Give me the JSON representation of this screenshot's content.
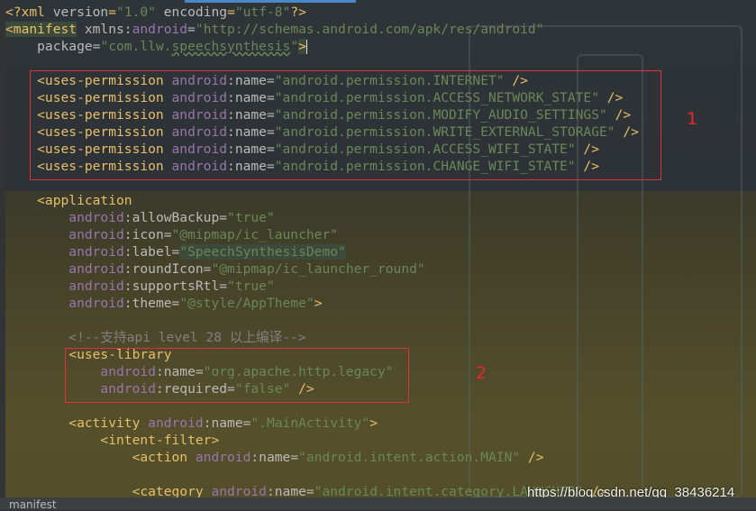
{
  "editor": {
    "lines": [
      {
        "tokens": [
          {
            "c": "p",
            "s": "<?xml "
          },
          {
            "c": "a",
            "s": "version"
          },
          {
            "c": "p",
            "s": "="
          },
          {
            "c": "v",
            "s": "\"1.0\""
          },
          {
            "c": "p",
            "s": " "
          },
          {
            "c": "a",
            "s": "encoding"
          },
          {
            "c": "p",
            "s": "="
          },
          {
            "c": "v",
            "s": "\"utf-8\""
          },
          {
            "c": "p",
            "s": "?>"
          }
        ]
      },
      {
        "tokens": [
          {
            "c": "t sel",
            "s": "<manifest"
          },
          {
            "c": "a",
            "s": " xmlns:"
          },
          {
            "c": "ns",
            "s": "android"
          },
          {
            "c": "a",
            "s": "="
          },
          {
            "c": "v",
            "s": "\"http://schemas.android.com/apk/res/android\""
          }
        ]
      },
      {
        "tokens": [
          {
            "c": "a",
            "s": "    package="
          },
          {
            "c": "v",
            "s": "\"com.llw."
          },
          {
            "c": "v sq",
            "s": "speechsynthesis"
          },
          {
            "c": "v",
            "s": "\""
          },
          {
            "c": "t sel",
            "s": ">"
          }
        ],
        "cursor": true
      },
      {
        "tokens": []
      },
      {
        "tokens": [
          {
            "c": "t",
            "s": "    <uses-permission "
          },
          {
            "c": "ns",
            "s": "android"
          },
          {
            "c": "a",
            "s": ":name="
          },
          {
            "c": "v",
            "s": "\"android.permission.INTERNET\""
          },
          {
            "c": "t",
            "s": " />"
          }
        ]
      },
      {
        "tokens": [
          {
            "c": "t",
            "s": "    <uses-permission "
          },
          {
            "c": "ns",
            "s": "android"
          },
          {
            "c": "a",
            "s": ":name="
          },
          {
            "c": "v",
            "s": "\"android.permission.ACCESS_NETWORK_STATE\""
          },
          {
            "c": "t",
            "s": " />"
          }
        ]
      },
      {
        "tokens": [
          {
            "c": "t",
            "s": "    <uses-permission "
          },
          {
            "c": "ns",
            "s": "android"
          },
          {
            "c": "a",
            "s": ":name="
          },
          {
            "c": "v",
            "s": "\"android.permission.MODIFY_AUDIO_SETTINGS\""
          },
          {
            "c": "t",
            "s": " />"
          }
        ]
      },
      {
        "tokens": [
          {
            "c": "t",
            "s": "    <uses-permission "
          },
          {
            "c": "ns",
            "s": "android"
          },
          {
            "c": "a",
            "s": ":name="
          },
          {
            "c": "v",
            "s": "\"android.permission.WRITE_EXTERNAL_STORAGE\""
          },
          {
            "c": "t",
            "s": " />"
          }
        ]
      },
      {
        "tokens": [
          {
            "c": "t",
            "s": "    <uses-permission "
          },
          {
            "c": "ns",
            "s": "android"
          },
          {
            "c": "a",
            "s": ":name="
          },
          {
            "c": "v",
            "s": "\"android.permission.ACCESS_WIFI_STATE\""
          },
          {
            "c": "t",
            "s": " />"
          }
        ]
      },
      {
        "tokens": [
          {
            "c": "t",
            "s": "    <uses-permission "
          },
          {
            "c": "ns",
            "s": "android"
          },
          {
            "c": "a",
            "s": ":name="
          },
          {
            "c": "v",
            "s": "\"android.permission.CHANGE_WIFI_STATE\""
          },
          {
            "c": "t",
            "s": " />"
          }
        ]
      },
      {
        "tokens": []
      },
      {
        "tokens": [
          {
            "c": "t",
            "s": "    <application"
          }
        ]
      },
      {
        "tokens": [
          {
            "c": "ns",
            "s": "        android"
          },
          {
            "c": "a",
            "s": ":allowBackup="
          },
          {
            "c": "v",
            "s": "\"true\""
          }
        ]
      },
      {
        "tokens": [
          {
            "c": "ns",
            "s": "        android"
          },
          {
            "c": "a",
            "s": ":icon="
          },
          {
            "c": "v",
            "s": "\"@mipmap/ic_launcher\""
          }
        ]
      },
      {
        "tokens": [
          {
            "c": "ns",
            "s": "        android"
          },
          {
            "c": "a",
            "s": ":label="
          },
          {
            "c": "v sel",
            "s": "\"SpeechSynthesisDemo\""
          }
        ]
      },
      {
        "tokens": [
          {
            "c": "ns",
            "s": "        android"
          },
          {
            "c": "a",
            "s": ":roundIcon="
          },
          {
            "c": "v",
            "s": "\"@mipmap/ic_launcher_round\""
          }
        ]
      },
      {
        "tokens": [
          {
            "c": "ns",
            "s": "        android"
          },
          {
            "c": "a",
            "s": ":supportsRtl="
          },
          {
            "c": "v",
            "s": "\"true\""
          }
        ]
      },
      {
        "tokens": [
          {
            "c": "ns",
            "s": "        android"
          },
          {
            "c": "a",
            "s": ":theme="
          },
          {
            "c": "v",
            "s": "\"@style/AppTheme\""
          },
          {
            "c": "t",
            "s": ">"
          }
        ]
      },
      {
        "tokens": []
      },
      {
        "tokens": [
          {
            "c": "c",
            "s": "        <!--支持api level 28 以上编译-->"
          }
        ]
      },
      {
        "tokens": [
          {
            "c": "t",
            "s": "        <uses-library"
          }
        ]
      },
      {
        "tokens": [
          {
            "c": "ns",
            "s": "            android"
          },
          {
            "c": "a",
            "s": ":name="
          },
          {
            "c": "v",
            "s": "\"org.apache.http.legacy\""
          }
        ]
      },
      {
        "tokens": [
          {
            "c": "ns",
            "s": "            android"
          },
          {
            "c": "a",
            "s": ":required="
          },
          {
            "c": "v",
            "s": "\"false\""
          },
          {
            "c": "t",
            "s": " />"
          }
        ]
      },
      {
        "tokens": []
      },
      {
        "tokens": [
          {
            "c": "t",
            "s": "        <activity "
          },
          {
            "c": "ns",
            "s": "android"
          },
          {
            "c": "a",
            "s": ":name="
          },
          {
            "c": "v",
            "s": "\".MainActivity\""
          },
          {
            "c": "t",
            "s": ">"
          }
        ]
      },
      {
        "tokens": [
          {
            "c": "t",
            "s": "            <intent-filter>"
          }
        ]
      },
      {
        "tokens": [
          {
            "c": "t",
            "s": "                <action "
          },
          {
            "c": "ns",
            "s": "android"
          },
          {
            "c": "a",
            "s": ":name="
          },
          {
            "c": "v",
            "s": "\"android.intent.action.MAIN\""
          },
          {
            "c": "t",
            "s": " />"
          }
        ]
      },
      {
        "tokens": []
      },
      {
        "tokens": [
          {
            "c": "t",
            "s": "                <category "
          },
          {
            "c": "ns",
            "s": "android"
          },
          {
            "c": "a",
            "s": ":name="
          },
          {
            "c": "v",
            "s": "\"android.intent.category.LAUNCHER\""
          },
          {
            "c": "t",
            "s": " />"
          }
        ]
      }
    ]
  },
  "annotations": {
    "box1_label": "1",
    "box2_label": "2"
  },
  "status_bar": {
    "breadcrumb": "manifest"
  },
  "watermark": {
    "text": "https://blog.csdn.net/qq_38436214"
  },
  "colors": {
    "tag": "#e8bf6a",
    "attribute": "#bababa",
    "namespace": "#9876aa",
    "string": "#6a8759",
    "comment": "#808080",
    "annotation_red": "#e03232"
  }
}
